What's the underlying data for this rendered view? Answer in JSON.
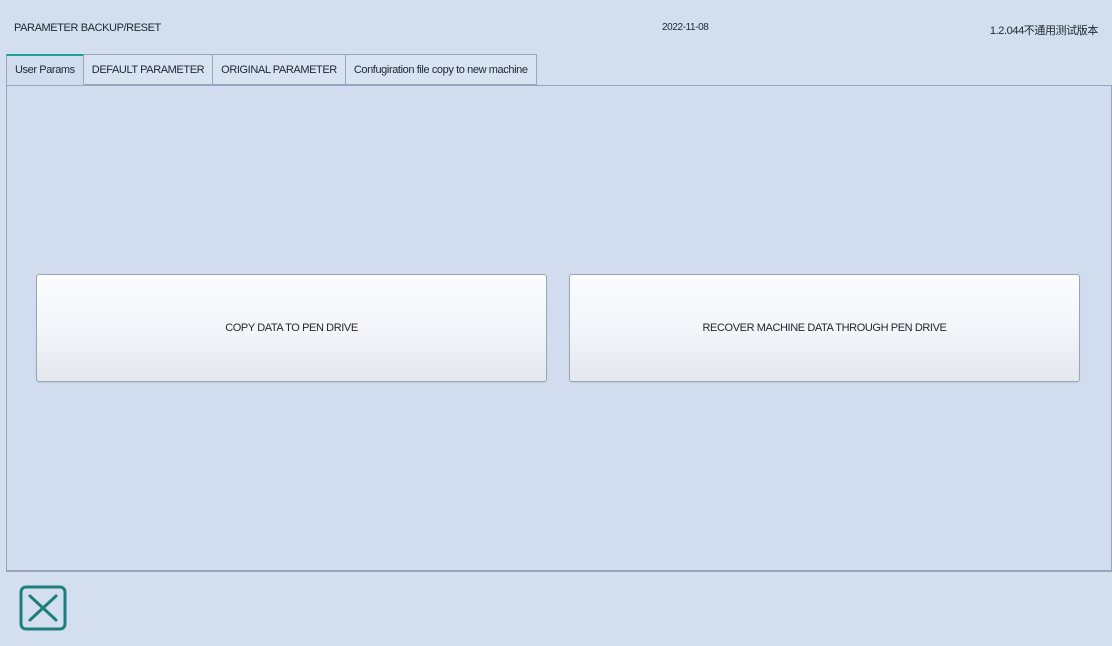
{
  "header": {
    "title": "PARAMETER BACKUP/RESET",
    "date": "2022-11-08",
    "version": "1.2.044不通用测试版本"
  },
  "tabs": [
    {
      "label": "User Params",
      "active": true
    },
    {
      "label": "DEFAULT PARAMETER",
      "active": false
    },
    {
      "label": "ORIGINAL PARAMETER",
      "active": false
    },
    {
      "label": "Confugiration file copy  to new machine",
      "active": false
    }
  ],
  "actions": {
    "copy_label": "COPY DATA TO PEN DRIVE",
    "recover_label": "RECOVER MACHINE DATA THROUGH PEN DRIVE"
  },
  "footer": {
    "close_icon": "close-icon"
  },
  "colors": {
    "background": "#d3dfef",
    "accent": "#1f9fa0",
    "border": "#96a7bd",
    "icon": "#1c7f7d"
  }
}
